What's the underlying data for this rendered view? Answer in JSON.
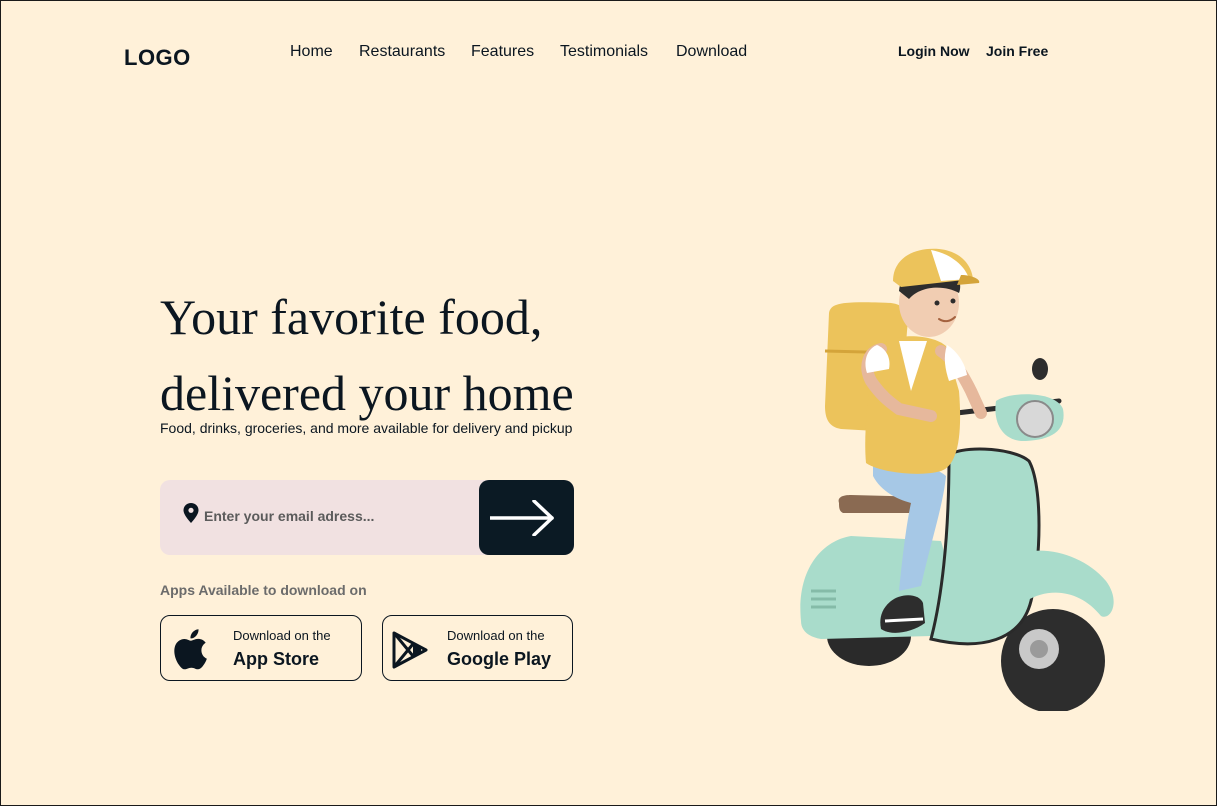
{
  "header": {
    "logo": "LOGO",
    "nav": [
      "Home",
      "Restaurants",
      "Features",
      "Testimonials",
      "Download"
    ],
    "login": "Login Now",
    "join": "Join Free"
  },
  "hero": {
    "title_line1": "Your favorite food,",
    "title_line2": "delivered your home",
    "subtitle": "Food, drinks, groceries, and more available for delivery and pickup"
  },
  "search": {
    "placeholder": "Enter your email adress...",
    "value": "",
    "icon": "location-pin-icon",
    "submit_icon": "arrow-right-icon"
  },
  "apps": {
    "label": "Apps Available to download on",
    "app_store": {
      "small": "Download on the",
      "big": "App Store",
      "icon": "apple-icon"
    },
    "google_play": {
      "small": "Download on the",
      "big": "Google Play",
      "icon": "play-icon"
    }
  },
  "colors": {
    "background": "#fff1d9",
    "text": "#0b1620",
    "input_bg": "#f1e1e1",
    "button_dark": "#0b1a24"
  }
}
